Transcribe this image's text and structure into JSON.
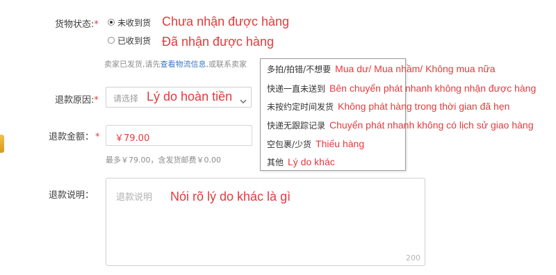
{
  "goods_status": {
    "label": "货物状态:",
    "required_mark": "*",
    "options": [
      {
        "text": "未收到货",
        "annotation": "Chưa nhận được hàng",
        "checked": true
      },
      {
        "text": "已收到货",
        "annotation": "Đã nhận được hàng",
        "checked": false
      }
    ],
    "hint_prefix": "卖家已发货,请先",
    "hint_link": "查看物流信息",
    "hint_suffix": ",或联系卖家"
  },
  "refund_reason": {
    "label": "退款原因:",
    "required_mark": "*",
    "placeholder": "请选择",
    "annotation": "Lý do hoàn tiền",
    "arrow": "chevron-down-icon",
    "dropdown": [
      {
        "cn": "多拍/拍错/不想要",
        "vi": "Mua dư/ Mua nhầm/ Không mua nữa"
      },
      {
        "cn": "快递一直未送到",
        "vi": "Bên chuyển phát nhanh không nhận được hàng"
      },
      {
        "cn": "未按约定时间发货",
        "vi": "Không phát hàng trong thời gian đã hẹn"
      },
      {
        "cn": "快递无跟踪记录",
        "vi": "Chuyển phát nhanh không có lịch sử giao hàng"
      },
      {
        "cn": "空包裹/少货",
        "vi": "Thiếu hàng"
      },
      {
        "cn": "其他",
        "vi": "Lý do khác"
      }
    ]
  },
  "refund_amount": {
    "label": "退款金额：",
    "required_mark": "*",
    "value": "￥79.00",
    "hint": "最多￥79.00，含发货邮费￥0.00"
  },
  "refund_note": {
    "label": "退款说明：",
    "placeholder": "退款说明",
    "annotation": "Nói rõ lý do khác là gì",
    "counter": "200"
  },
  "colors": {
    "accent_red": "#e4393c",
    "link_blue": "#3c78c8"
  }
}
